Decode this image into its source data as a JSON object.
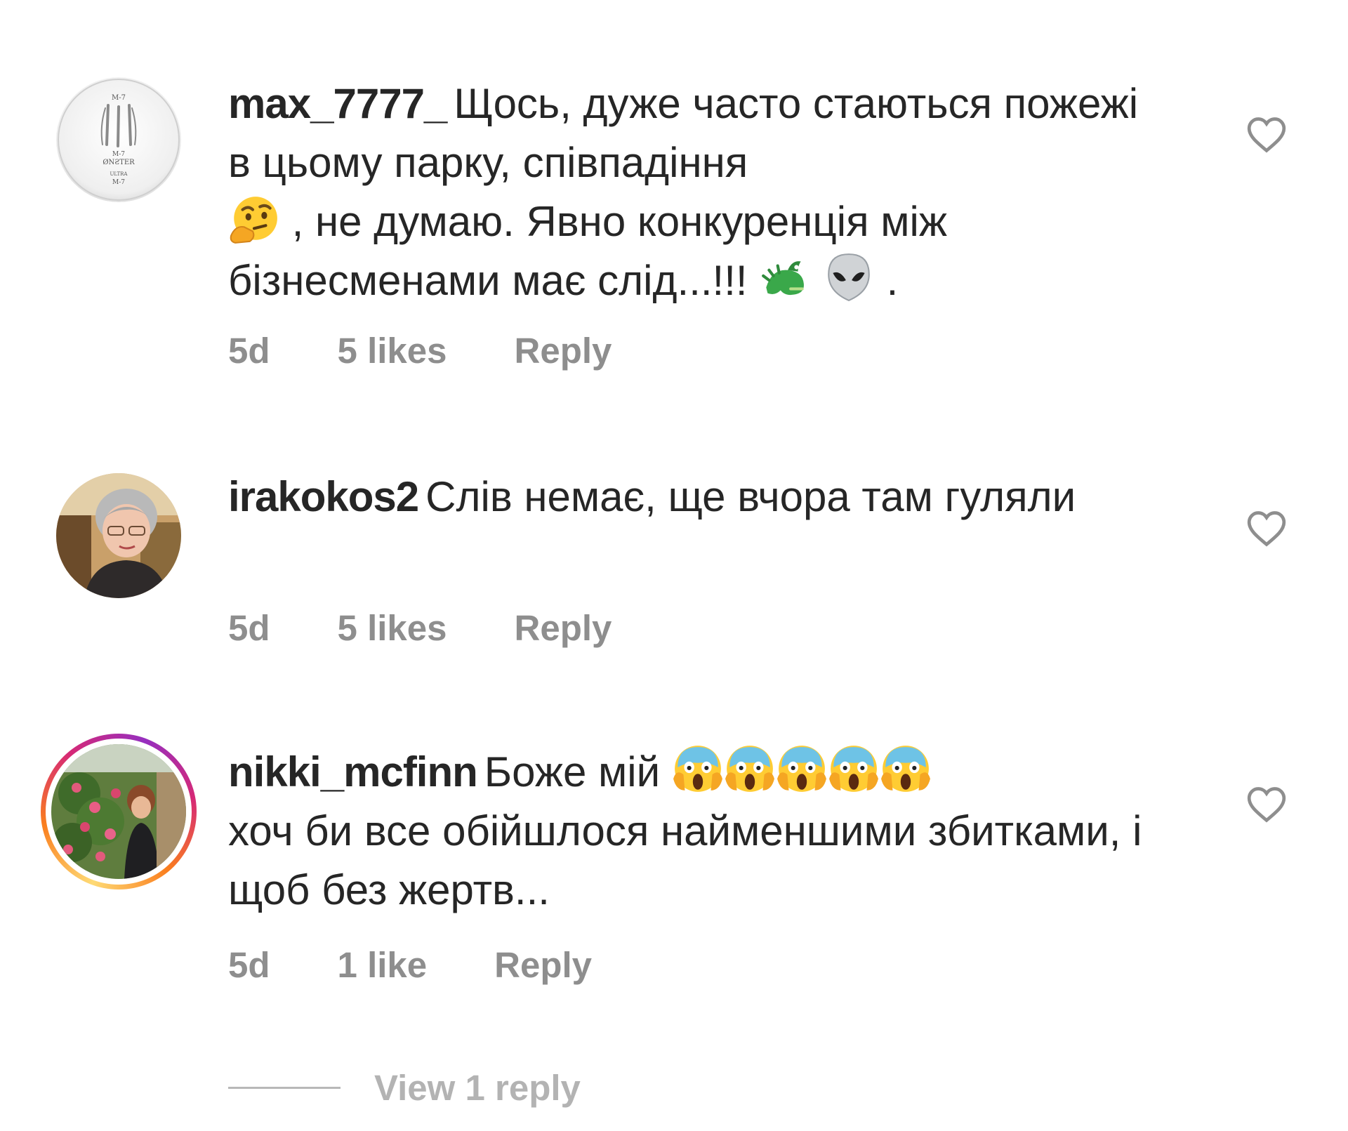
{
  "colors": {
    "text": "#262626",
    "secondary": "#8e8e8e",
    "icon": "#8e8e8e",
    "story_ring": [
      "#feda75",
      "#fa7e1e",
      "#d62976",
      "#962fbf"
    ]
  },
  "comments": [
    {
      "username": "max_7777_",
      "text_1": "Щось, дуже часто стаються пожежі в цьому парку, співпадіння",
      "text_2": ", не думаю. Явно конкуренція між бізнесменами має слід...!!!",
      "text_3": ".",
      "emojis": [
        "thinking-face-emoji",
        "dragon-emoji",
        "alien-emoji"
      ],
      "time": "5d",
      "likes": "5 likes",
      "reply": "Reply",
      "avatar_text": [
        "M-7",
        "M-7",
        "ØNƧTER",
        "ULTRA",
        "M-7"
      ],
      "like_icon": "heart-icon"
    },
    {
      "username": "irakokos2",
      "text": "Слів немає, ще вчора там гуляли",
      "time": "5d",
      "likes": "5 likes",
      "reply": "Reply",
      "like_icon": "heart-icon"
    },
    {
      "username": "nikki_mcfinn",
      "text_1": "Боже мій",
      "text_2": "хоч би все обійшлося найменшими збитками, і щоб без жертв...",
      "emojis": [
        "screaming-face-emoji",
        "screaming-face-emoji",
        "screaming-face-emoji",
        "screaming-face-emoji",
        "screaming-face-emoji"
      ],
      "time": "5d",
      "likes": "1 like",
      "reply": "Reply",
      "like_icon": "heart-icon",
      "has_story": true
    }
  ],
  "view_replies": "View 1 reply"
}
